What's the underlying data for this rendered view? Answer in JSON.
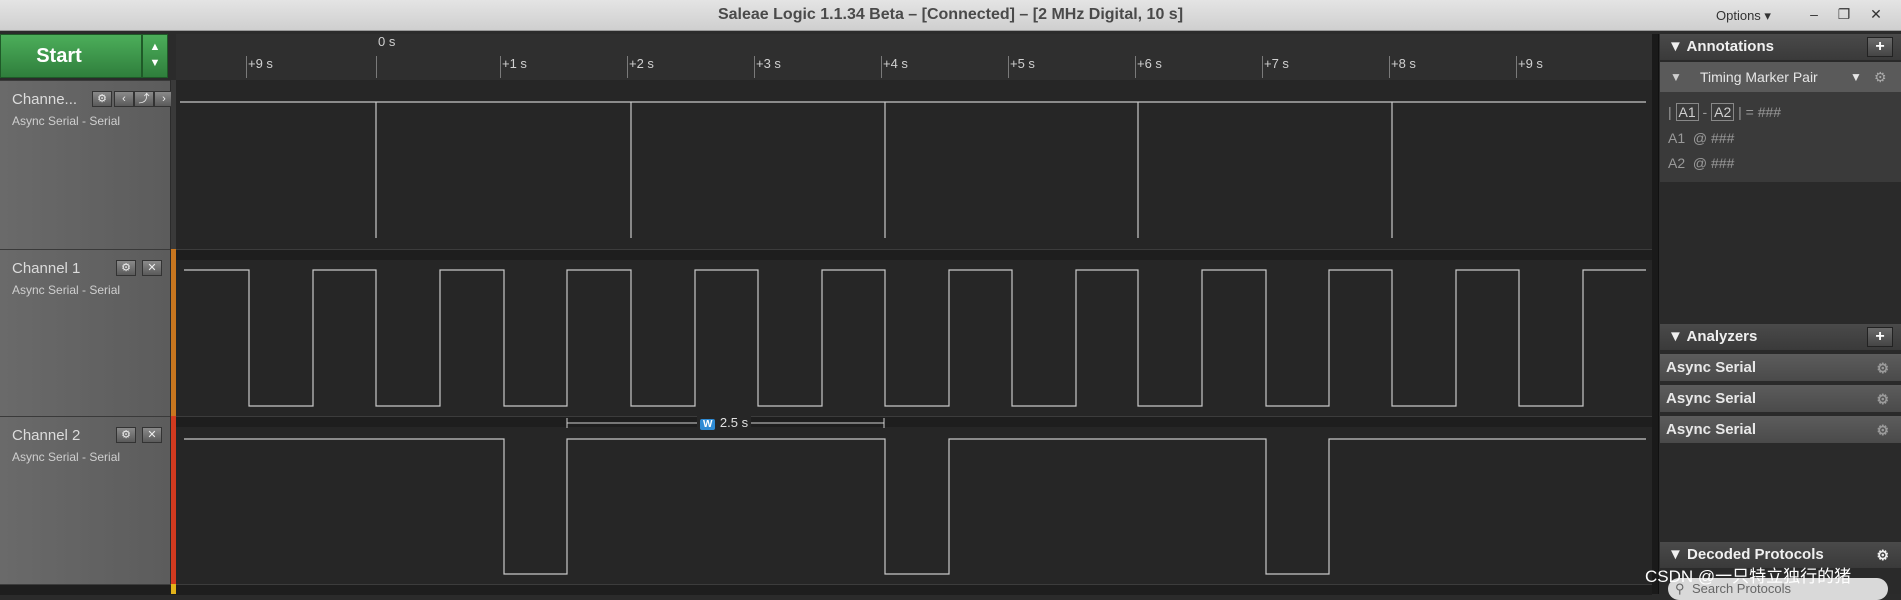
{
  "window": {
    "title": "Saleae Logic 1.1.34 Beta – [Connected] – [2 MHz Digital, 10 s]",
    "options_label": "Options ▾",
    "minimize": "–",
    "restore": "❐",
    "close": "✕"
  },
  "start": {
    "label": "Start",
    "arrows": "▲\n▼"
  },
  "channels": [
    {
      "name": "Channe...",
      "sub": "Async Serial - Serial"
    },
    {
      "name": "Channel 1",
      "sub": "Async Serial - Serial"
    },
    {
      "name": "Channel 2",
      "sub": "Async Serial - Serial"
    }
  ],
  "timeline": {
    "zero_label": "0 s",
    "ticks": [
      "+9 s",
      "+1 s",
      "+2 s",
      "+3 s",
      "+4 s",
      "+5 s",
      "+6 s",
      "+7 s",
      "+8 s",
      "+9 s"
    ]
  },
  "measurement": {
    "badge": "W",
    "value": "2.5 s"
  },
  "annotations": {
    "title": "Annotations",
    "marker_pair": "Timing Marker Pair",
    "line1": "= ###",
    "a1": "A1",
    "a2": "A2",
    "a1_line": "@ ###",
    "a2_line": "@ ###"
  },
  "analyzers": {
    "title": "Analyzers",
    "items": [
      "Async Serial",
      "Async Serial",
      "Async Serial"
    ]
  },
  "decoded": {
    "title": "Decoded Protocols",
    "search_placeholder": "Search Protocols"
  },
  "watermark": "CSDN @一只特立独行的猪",
  "colors": {
    "start_green": "#3f9a4c",
    "ch1_strip": "#c8761f",
    "ch2_strip": "#d23a1f",
    "badge": "#2f8bd4"
  }
}
